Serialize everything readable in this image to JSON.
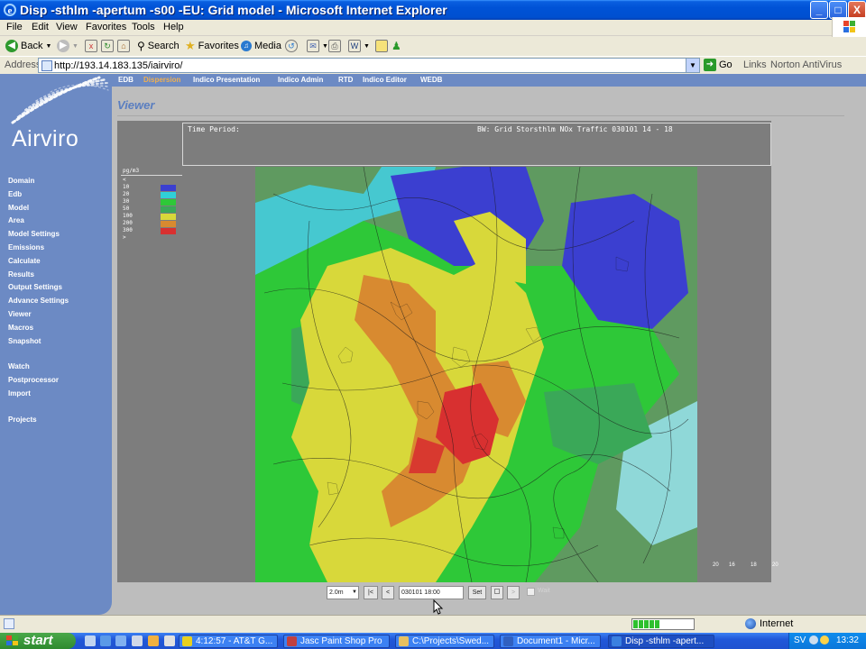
{
  "window": {
    "title": "Disp -sthlm -apertum -s00 -EU: Grid model - Microsoft Internet Explorer",
    "controls": [
      "_",
      "□",
      "X"
    ]
  },
  "menu": [
    "File",
    "Edit",
    "View",
    "Favorites",
    "Tools",
    "Help"
  ],
  "toolbar": {
    "back": "Back",
    "search": "Search",
    "favorites": "Favorites",
    "media": "Media"
  },
  "address": {
    "label": "Address",
    "url": "http://193.14.183.135/iairviro/",
    "go": "Go",
    "links": "Links",
    "norton": "Norton AntiVirus"
  },
  "app": {
    "logo_text": "Airviro",
    "top_nav": [
      {
        "label": "EDB",
        "active": false
      },
      {
        "label": "Dispersion",
        "active": true
      },
      {
        "label": "Indico Presentation",
        "active": false
      },
      {
        "label": "Indico Admin",
        "active": false
      },
      {
        "label": "RTD",
        "active": false
      },
      {
        "label": "Indico Editor",
        "active": false
      },
      {
        "label": "WEDB",
        "active": false
      }
    ],
    "side_nav": [
      "Domain",
      "Edb",
      "Model",
      "Area",
      "Model Settings",
      "Emissions",
      "Calculate",
      "Results",
      "Output Settings",
      "Advance Settings",
      "Viewer",
      "Macros",
      "Snapshot",
      "Watch",
      "Postprocessor",
      "Import",
      "Projects"
    ],
    "page_title": "Viewer"
  },
  "viewer": {
    "time_period_label": "Time Period:",
    "bw_label": "BW: Grid Storsthlm NOx Traffic 030101 14 - 18",
    "legend": {
      "unit": "pg/m3",
      "rows": [
        {
          "label": "<",
          "color": null
        },
        {
          "label": "10",
          "color": "#3b3fd0"
        },
        {
          "label": "20",
          "color": "#2fd0d8"
        },
        {
          "label": "30",
          "color": "#2ec838"
        },
        {
          "label": "50",
          "color": "#3aa858"
        },
        {
          "label": "100",
          "color": "#d8d83a"
        },
        {
          "label": "200",
          "color": "#d88a30"
        },
        {
          "label": "300",
          "color": "#d83030"
        },
        {
          "label": ">",
          "color": null
        }
      ]
    },
    "scale_ticks": [
      "20",
      "16",
      "18",
      "20"
    ],
    "controls": {
      "resolution": "2.0m",
      "first": "|<",
      "prev": "<",
      "time_value": "030101 18:00",
      "set": "Set",
      "next": ">",
      "wait": "Wait"
    }
  },
  "status": {
    "zone": "Internet"
  },
  "taskbar": {
    "start": "start",
    "tasks": [
      {
        "label": "4:12:57 - AT&T G...",
        "color": "#e8d020",
        "active": false
      },
      {
        "label": "Jasc Paint Shop Pro",
        "color": "#c04040",
        "active": false
      },
      {
        "label": "C:\\Projects\\Swed...",
        "color": "#e8c060",
        "active": false
      },
      {
        "label": "Document1 - Micr...",
        "color": "#3060c0",
        "active": false
      },
      {
        "label": "Disp -sthlm -apert...",
        "color": "#3a80e0",
        "active": true
      }
    ],
    "lang": "SV",
    "clock": "13:32"
  }
}
